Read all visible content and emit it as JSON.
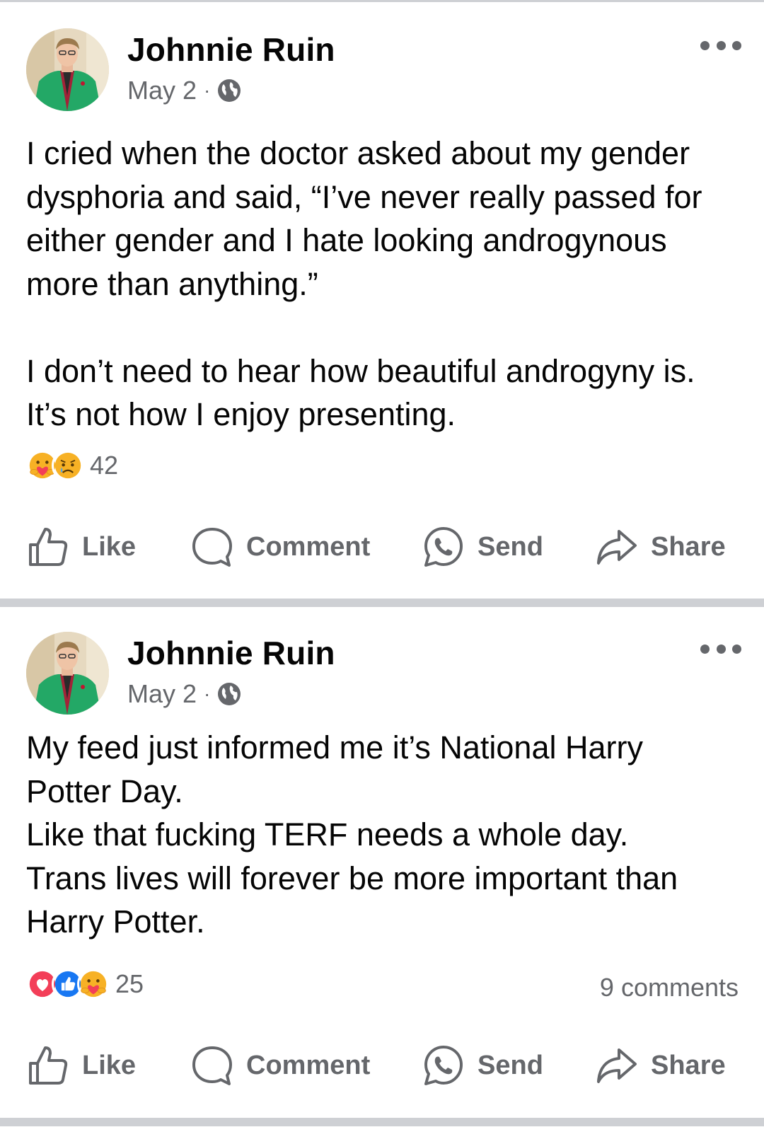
{
  "posts": [
    {
      "author": "Johnnie Ruin",
      "date": "May 2",
      "separator": "·",
      "privacy_icon": "globe-icon",
      "text_lines": [
        "I cried when the doctor asked about my gender",
        "dysphoria and said, “I’ve never really passed for",
        "either gender and I hate looking androgynous",
        "more than anything.”",
        "",
        "I don’t need to hear how beautiful androgyny is.",
        "It’s not how I enjoy presenting."
      ],
      "reactions": [
        "care",
        "sad"
      ],
      "reaction_count": "42",
      "comments_count": "",
      "actions": {
        "like": "Like",
        "comment": "Comment",
        "send": "Send",
        "share": "Share"
      }
    },
    {
      "author": "Johnnie Ruin",
      "date": "May 2",
      "separator": "·",
      "privacy_icon": "globe-icon",
      "text_lines": [
        "My feed just informed me it’s National Harry",
        "Potter Day.",
        "Like that fucking TERF needs a whole day.",
        "Trans lives will forever be more important than",
        "Harry Potter."
      ],
      "reactions": [
        "love",
        "like",
        "care"
      ],
      "reaction_count": "25",
      "comments_count": "9 comments",
      "actions": {
        "like": "Like",
        "comment": "Comment",
        "send": "Send",
        "share": "Share"
      }
    }
  ],
  "colors": {
    "text": "#050505",
    "secondary": "#65676b",
    "divider": "#ced0d4",
    "like_blue": "#1877f2",
    "love_red": "#f33e58",
    "reaction_yellow": "#f7b125"
  }
}
